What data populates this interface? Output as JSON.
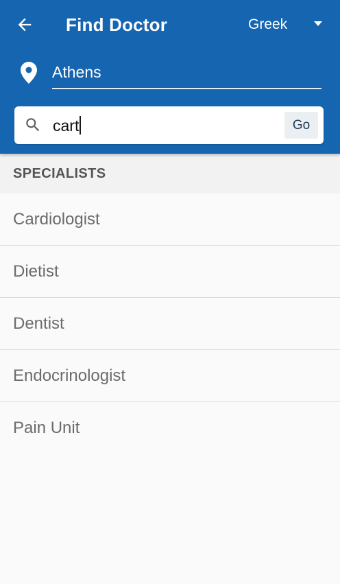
{
  "header": {
    "title": "Find Doctor",
    "language": "Greek",
    "back_icon": "arrow-left-icon",
    "dropdown_icon": "caret-down-icon",
    "background_color": "#1665b0"
  },
  "location": {
    "icon": "location-pin-icon",
    "value": "Athens"
  },
  "search": {
    "icon": "search-icon",
    "value": "cart",
    "go_label": "Go"
  },
  "section": {
    "label": "SPECIALISTS"
  },
  "specialists": [
    {
      "label": "Cardiologist"
    },
    {
      "label": "Dietist"
    },
    {
      "label": "Dentist"
    },
    {
      "label": "Endocrinologist"
    },
    {
      "label": "Pain Unit"
    }
  ]
}
